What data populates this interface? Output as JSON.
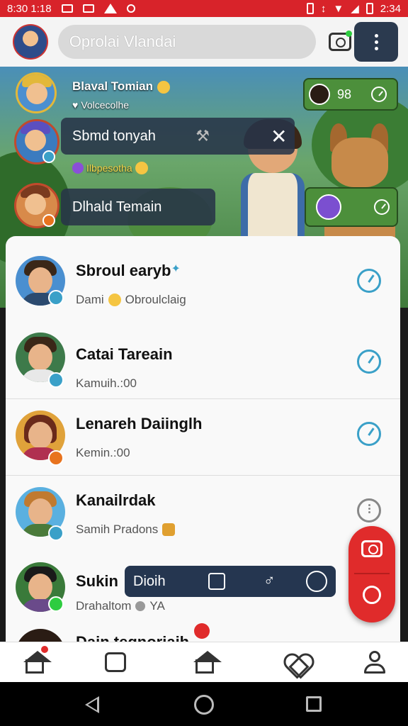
{
  "status_bar": {
    "time_left": "8:30 1:18",
    "time_right": "2:34"
  },
  "app_bar": {
    "search_text": "Oprolai Vlandai"
  },
  "featured": [
    {
      "name": "Blaval Tomian",
      "subtitle": "Volcecolhe",
      "chip_count": "98"
    },
    {
      "chip_text": "Sbmd tonyah",
      "subtitle": "Ilbpesotha"
    },
    {
      "chip_text": "Dlhald Temain"
    }
  ],
  "contacts": [
    {
      "name": "Sbroul earyb",
      "subtitle": "Dami",
      "subtitle_extra": "Obroulclaig",
      "badge_color": "#3aa0c8"
    },
    {
      "name": "Catai Tareain",
      "subtitle": "Kamuih.:00",
      "badge_color": "#3aa0c8"
    },
    {
      "name": "Lenareh Daiinglh",
      "subtitle": "Kemin.:00",
      "badge_color": "#e8731e"
    },
    {
      "name": "Kanailrdak",
      "subtitle": "Samih Pradons",
      "badge_color": "#3aa0c8"
    },
    {
      "name": "Sukin",
      "subtitle": "Drahaltom",
      "subtitle_extra": "YA",
      "badge_color": "#2ecc40"
    },
    {
      "name": "Dain tegnoriaih"
    }
  ],
  "overlay_toolbar": {
    "label": "Dioih"
  },
  "colors": {
    "status_bar": "#d8232a",
    "accent_blue": "#3aa0c8",
    "fab_red": "#e02b2b",
    "dark_chip": "#283448"
  },
  "icons": {
    "app_bar": [
      "camera-icon",
      "more-vert-icon"
    ],
    "bottom_nav": [
      "home-icon",
      "chat-icon",
      "house-icon",
      "heart-icon",
      "profile-icon"
    ],
    "fab": [
      "camera-icon",
      "edit-icon"
    ]
  }
}
